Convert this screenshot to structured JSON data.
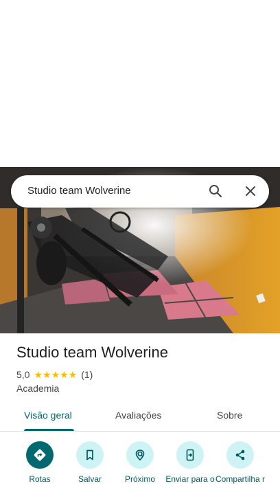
{
  "search": {
    "query": "Studio team Wolverine"
  },
  "place": {
    "name": "Studio team Wolverine",
    "rating": "5,0",
    "stars": "★★★★★",
    "review_count": "(1)",
    "category": "Academia"
  },
  "tabs": [
    {
      "label": "Visão geral",
      "active": true
    },
    {
      "label": "Avaliações",
      "active": false
    },
    {
      "label": "Sobre",
      "active": false
    }
  ],
  "actions": [
    {
      "label": "Rotas",
      "icon": "directions-icon"
    },
    {
      "label": "Salvar",
      "icon": "bookmark-icon"
    },
    {
      "label": "Próximo",
      "icon": "nearby-icon"
    },
    {
      "label": "Enviar para o",
      "icon": "send-to-phone-icon"
    },
    {
      "label": "Compartilha r",
      "icon": "share-icon"
    }
  ],
  "colors": {
    "accent": "#00696f",
    "accent_light": "#cdf3f5",
    "star": "#fbbc04"
  }
}
